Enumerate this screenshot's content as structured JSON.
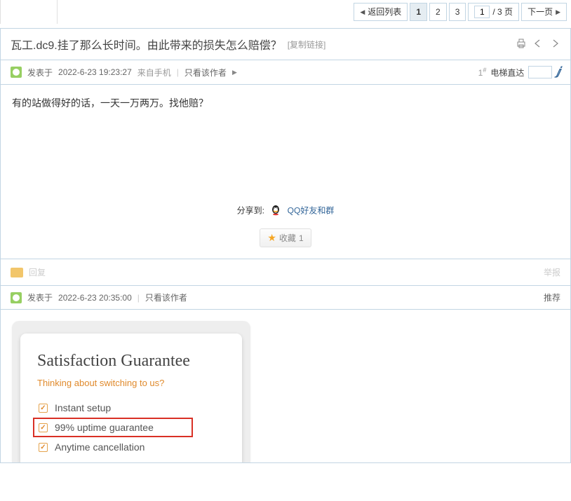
{
  "pagination": {
    "back_label": "返回列表",
    "pages": [
      "1",
      "2",
      "3"
    ],
    "current": "1",
    "goto_value": "1",
    "total_label": "/ 3 页",
    "next_label": "下一页"
  },
  "thread": {
    "title": "瓦工.dc9.挂了那么长时间。由此带来的损失怎么赔偿？",
    "copylink": "[复制链接]"
  },
  "post1": {
    "meta_prefix": "发表于",
    "timestamp": "2022-6-23 19:23:27",
    "from_mobile": "来自手机",
    "view_author_only": "只看该作者",
    "floor": "1",
    "floor_suffix": "#",
    "elevator_label": "电梯直达",
    "content": "有的站做得好的话，一天一万两万。找他赔？"
  },
  "share": {
    "label": "分享到:",
    "qq_label": "QQ好友和群"
  },
  "fav": {
    "label": "收藏",
    "count": "1"
  },
  "reply_strip": {
    "reply_label": "回复",
    "report_label": "举报"
  },
  "post2": {
    "meta_prefix": "发表于",
    "timestamp": "2022-6-23 20:35:00",
    "view_author_only": "只看该作者",
    "badge": "推荐"
  },
  "sat": {
    "title": "Satisfaction Guarantee",
    "subtitle": "Thinking about switching to us?",
    "items": [
      "Instant setup",
      "99% uptime guarantee",
      "Anytime cancellation"
    ]
  }
}
